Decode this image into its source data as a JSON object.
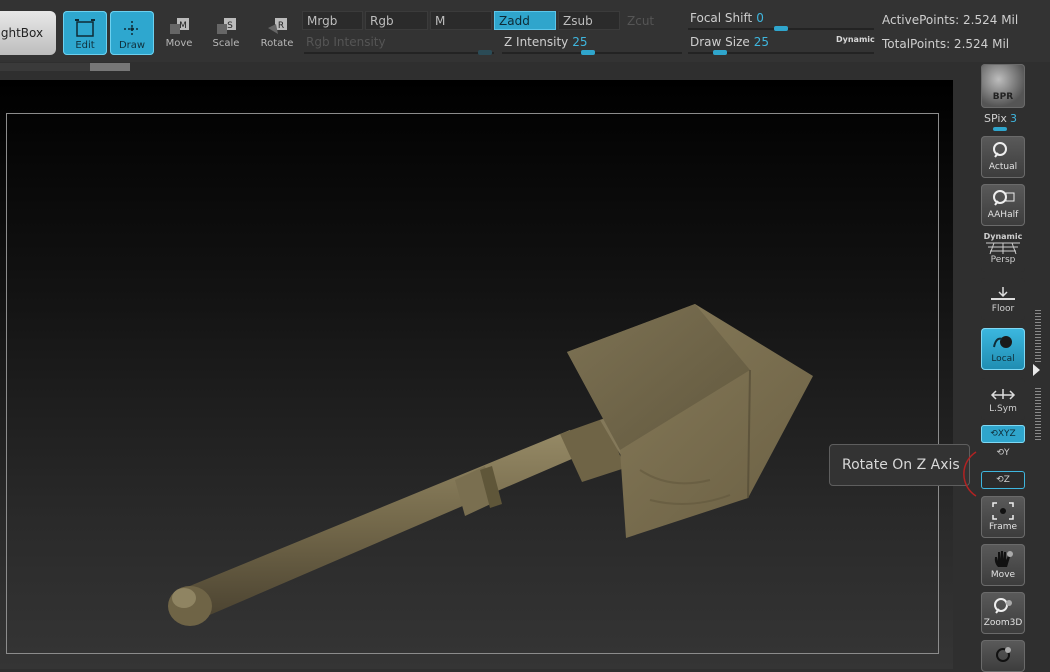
{
  "toolbar": {
    "lightbox_label": "LightBox",
    "edit_label": "Edit",
    "draw_label": "Draw",
    "move_label": "Move",
    "move_key": "M",
    "scale_label": "Scale",
    "scale_key": "S",
    "rotate_label": "Rotate",
    "rotate_key": "R",
    "mrgb_label": "Mrgb",
    "rgb_label": "Rgb",
    "m_label": "M",
    "zadd_label": "Zadd",
    "zsub_label": "Zsub",
    "zcut_label": "Zcut",
    "rgb_intensity_label": "Rgb Intensity",
    "z_intensity_label": "Z Intensity",
    "z_intensity_value": "25",
    "focal_shift_label": "Focal Shift",
    "focal_shift_value": "0",
    "draw_size_label": "Draw Size",
    "draw_size_value": "25",
    "dynamic_label": "Dynamic",
    "active_points": "ActivePoints: 2.524 Mil",
    "total_points": "TotalPoints: 2.524 Mil"
  },
  "tooltip": {
    "text": "Rotate On Z Axis"
  },
  "shelf": {
    "bpr_label": "BPR",
    "spix_label": "SPix",
    "spix_value": "3",
    "actual_label": "Actual",
    "aahalf_label": "AAHalf",
    "persp_label": "Persp",
    "persp_top": "Dynamic",
    "floor_label": "Floor",
    "local_label": "Local",
    "lsym_label": "L.Sym",
    "xyz_label": "XYZ",
    "y_label": "Y",
    "z_label": "Z",
    "frame_label": "Frame",
    "move_label": "Move",
    "zoom3d_label": "Zoom3D"
  },
  "colors": {
    "accent": "#2fa5cc",
    "background": "#2f2f2f",
    "model": "#7a6e4f"
  }
}
